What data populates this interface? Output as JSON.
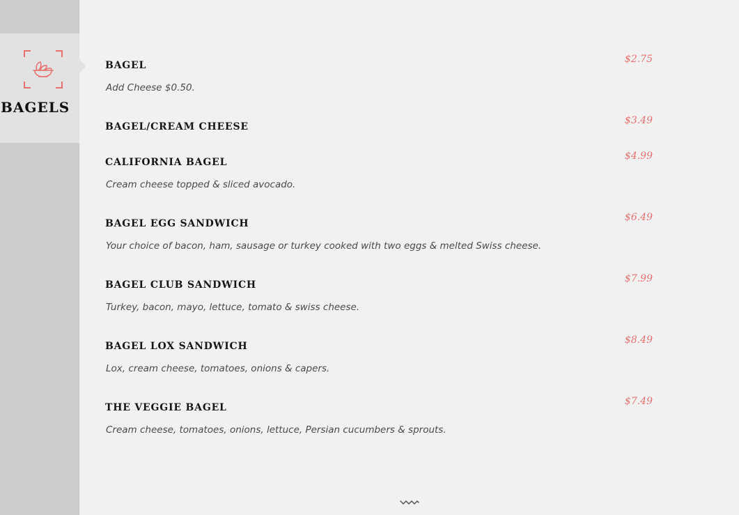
{
  "category": {
    "name": "BAGELS",
    "icon": "bowl-icon",
    "accent_color": "#e8716f"
  },
  "items": [
    {
      "name": "BAGEL",
      "price": "$2.75",
      "description": "Add Cheese $0.50."
    },
    {
      "name": "BAGEL/CREAM CHEESE",
      "price": "$3.49",
      "description": ""
    },
    {
      "name": "CALIFORNIA BAGEL",
      "price": "$4.99",
      "description": "Cream cheese topped & sliced avocado."
    },
    {
      "name": "BAGEL EGG SANDWICH",
      "price": "$6.49",
      "description": "Your choice of bacon, ham, sausage or turkey cooked with two eggs & melted Swiss cheese."
    },
    {
      "name": "BAGEL CLUB SANDWICH",
      "price": "$7.99",
      "description": "Turkey, bacon, mayo, lettuce, tomato & swiss cheese."
    },
    {
      "name": "BAGEL LOX SANDWICH",
      "price": "$8.49",
      "description": "Lox, cream cheese, tomatoes, onions & capers."
    },
    {
      "name": "THE VEGGIE BAGEL",
      "price": "$7.49",
      "description": "Cream cheese, tomatoes, onions, lettuce, Persian cucumbers & sprouts."
    }
  ],
  "scroll_indicator_icon": "wave-down-icon"
}
